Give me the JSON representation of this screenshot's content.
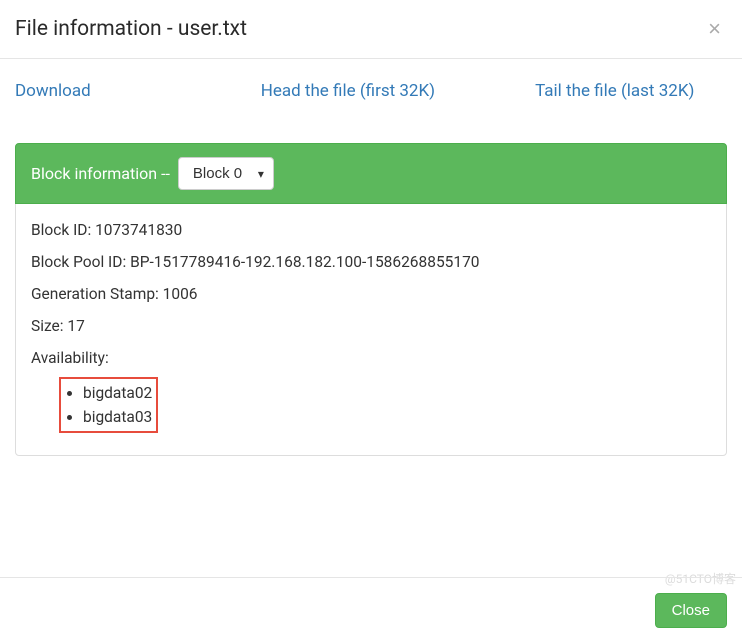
{
  "header": {
    "title": "File information - user.txt",
    "close_x": "×"
  },
  "actions": {
    "download": "Download",
    "head": "Head the file (first 32K)",
    "tail": "Tail the file (last 32K)"
  },
  "panel": {
    "heading_label": "Block information --",
    "selected_block": "Block 0"
  },
  "block": {
    "id_label": "Block ID:",
    "id_value": "1073741830",
    "pool_label": "Block Pool ID:",
    "pool_value": "BP-1517789416-192.168.182.100-1586268855170",
    "gen_label": "Generation Stamp:",
    "gen_value": "1006",
    "size_label": "Size:",
    "size_value": "17",
    "avail_label": "Availability:",
    "nodes": [
      "bigdata02",
      "bigdata03"
    ]
  },
  "footer": {
    "close_label": "Close"
  },
  "watermark": "@51CTO博客"
}
